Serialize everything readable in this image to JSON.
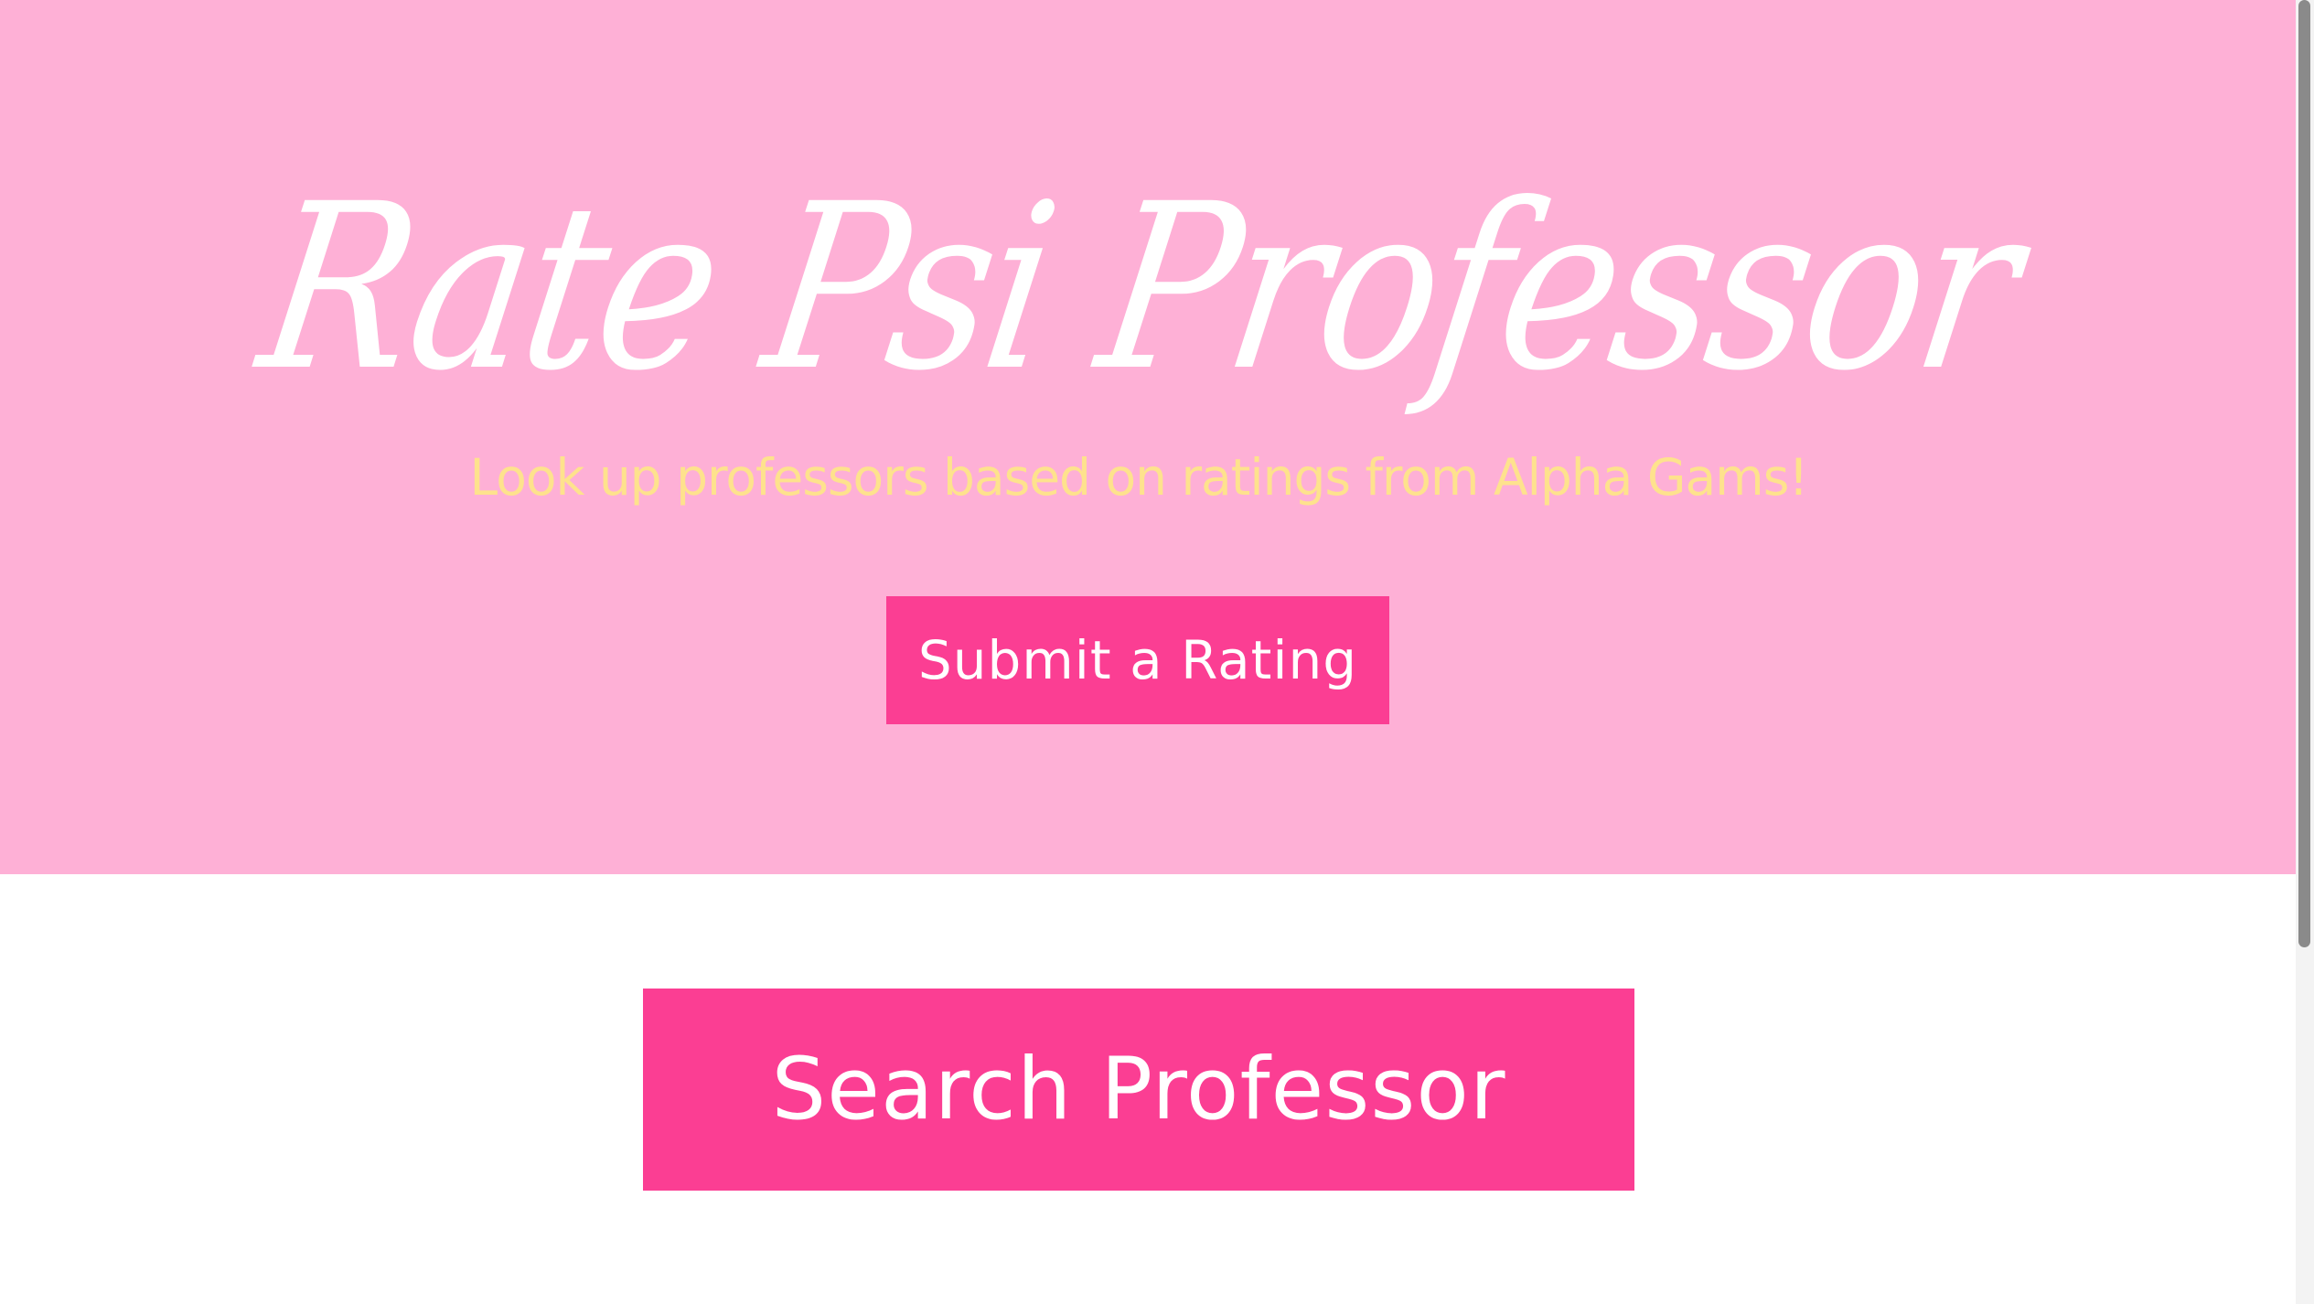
{
  "hero": {
    "title": "Rate Psi Professor",
    "subtitle": "Look up professors based on ratings from Alpha Gams!",
    "submit_button_label": "Submit a Rating"
  },
  "main": {
    "search_button_label": "Search Professor"
  },
  "colors": {
    "hero_background": "#feb0d6",
    "subtitle_text": "#fee28d",
    "button_background": "#fb3e93",
    "button_text": "#ffffff",
    "page_background": "#ffffff"
  }
}
